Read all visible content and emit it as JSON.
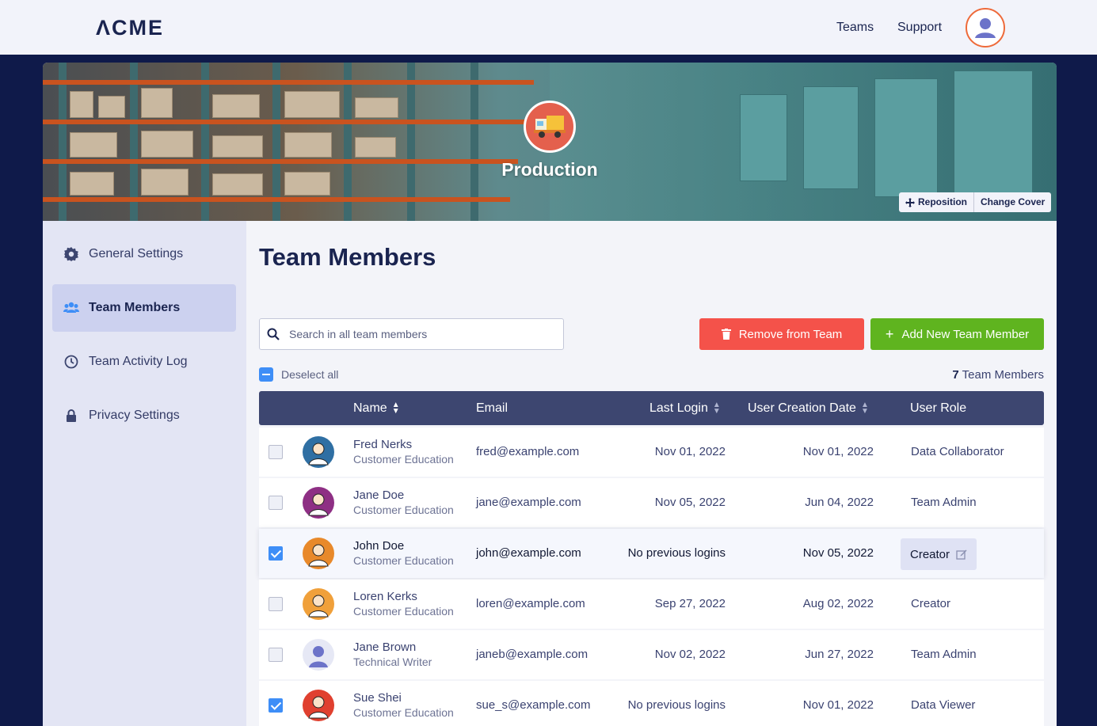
{
  "app": {
    "logo": "ΛCME"
  },
  "nav": {
    "teams": "Teams",
    "support": "Support"
  },
  "cover": {
    "team_name": "Production",
    "reposition_label": "Reposition",
    "change_cover_label": "Change Cover"
  },
  "sidebar": {
    "items": [
      {
        "label": "General Settings",
        "icon": "gear-icon"
      },
      {
        "label": "Team Members",
        "icon": "users-icon"
      },
      {
        "label": "Team Activity Log",
        "icon": "history-icon"
      },
      {
        "label": "Privacy Settings",
        "icon": "lock-icon"
      }
    ],
    "active": "Team Members"
  },
  "main": {
    "title": "Team Members",
    "search_placeholder": "Search in all team members",
    "remove_label": "Remove from Team",
    "add_label": "Add New Team Member",
    "deselect_label": "Deselect all",
    "member_count": "7",
    "member_count_suffix": " Team Members"
  },
  "table": {
    "headers": {
      "name": "Name",
      "email": "Email",
      "last_login": "Last Login",
      "created": "User Creation Date",
      "role": "User Role"
    },
    "rows": [
      {
        "checked": false,
        "name": "Fred Nerks",
        "dept": "Customer Education",
        "email": "fred@example.com",
        "last_login": "Nov 01, 2022",
        "created": "Nov 01, 2022",
        "role": "Data Collaborator",
        "avatar_color": "#2f6fa3"
      },
      {
        "checked": false,
        "name": "Jane Doe",
        "dept": "Customer Education",
        "email": "jane@example.com",
        "last_login": "Nov 05, 2022",
        "created": "Jun 04, 2022",
        "role": "Team Admin",
        "avatar_color": "#8e2f84"
      },
      {
        "checked": true,
        "name": "John Doe",
        "dept": "Customer Education",
        "email": "john@example.com",
        "last_login": "No previous logins",
        "created": "Nov 05, 2022",
        "role": "Creator",
        "avatar_color": "#e8892a"
      },
      {
        "checked": false,
        "name": "Loren Kerks",
        "dept": "Customer Education",
        "email": "loren@example.com",
        "last_login": "Sep 27, 2022",
        "created": "Aug 02, 2022",
        "role": "Creator",
        "avatar_color": "#f0a03a"
      },
      {
        "checked": false,
        "name": "Jane Brown",
        "dept": "Technical Writer",
        "email": "janeb@example.com",
        "last_login": "Nov 02, 2022",
        "created": "Jun 27, 2022",
        "role": "Team Admin",
        "avatar_color": "#e6e8f5"
      },
      {
        "checked": true,
        "name": "Sue Shei",
        "dept": "Customer Education",
        "email": "sue_s@example.com",
        "last_login": "No previous logins",
        "created": "Nov 01, 2022",
        "role": "Data Viewer",
        "avatar_color": "#e0402f"
      }
    ]
  },
  "colors": {
    "navy": "#0f1a4a",
    "remove": "#f4524a",
    "add": "#5fb41f",
    "header_row": "#3d4670",
    "checkbox": "#3e8ef7"
  }
}
